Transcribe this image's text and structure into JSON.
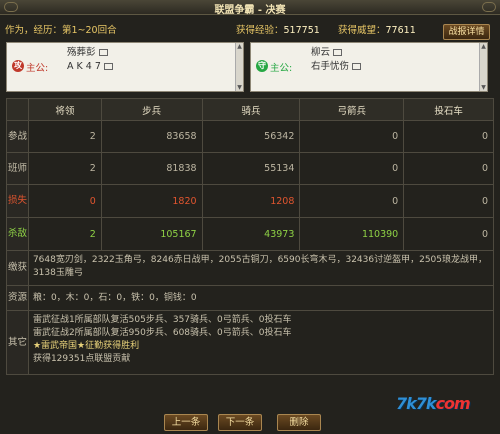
{
  "window": {
    "title": "联盟争霸 - 决赛"
  },
  "info": {
    "round_label": "作为，经历：第1~20回合",
    "exp_label": "获得经验：",
    "exp_value": "517751",
    "prestige_label": "获得威望：",
    "prestige_value": "77611",
    "detail_button": "战报详情"
  },
  "attacker": {
    "badge": "攻",
    "main_label": "主公:",
    "names": [
      "殇葬彭",
      "A K 4 7"
    ],
    "badge_color": "#c0392b"
  },
  "defender": {
    "badge": "守",
    "main_label": "主公:",
    "names": [
      "柳云",
      "右手忧伤"
    ],
    "badge_color": "#27a844"
  },
  "table": {
    "headers": [
      "将领",
      "步兵",
      "骑兵",
      "弓箭兵",
      "投石车"
    ],
    "rows": [
      {
        "label": "参战",
        "values": [
          "2",
          "83658",
          "56342",
          "0",
          "0"
        ]
      },
      {
        "label": "班师",
        "values": [
          "2",
          "81838",
          "55134",
          "0",
          "0"
        ]
      },
      {
        "label": "损失",
        "values": [
          "0",
          "1820",
          "1208",
          "0",
          "0"
        ]
      },
      {
        "label": "杀敌",
        "values": [
          "2",
          "105167",
          "43973",
          "110390",
          "0"
        ]
      }
    ],
    "spoils_label": "缴获",
    "spoils_text": "7648宽刃剑，2322玉角弓，8246赤日战甲，2055古铜刀，6590长弯木弓，32436讨逆盔甲，2505琅龙战甲，3138玉雕弓",
    "resources_label": "资源",
    "resources_text": "粮：0，木：0，石：0，铁：0，铜钱：0",
    "other_label": "其它",
    "other_lines": [
      "雷武征战1所属部队复活505步兵、357骑兵、0弓箭兵、0投石车",
      "雷武征战2所属部队复活950步兵、608骑兵、0弓箭兵、0投石车",
      "★雷武帝国★征勤获得胜利",
      "获得129351点联盟贡献"
    ]
  },
  "buttons": {
    "prev": "上一条",
    "next": "下一条",
    "delete": "删除"
  },
  "watermark": {
    "text_a": "7k",
    "text_b": "7k",
    "text_c": "com"
  },
  "colors": {
    "loss": "#e0552f",
    "kill": "#8ed145",
    "gold": "#e8c766"
  }
}
